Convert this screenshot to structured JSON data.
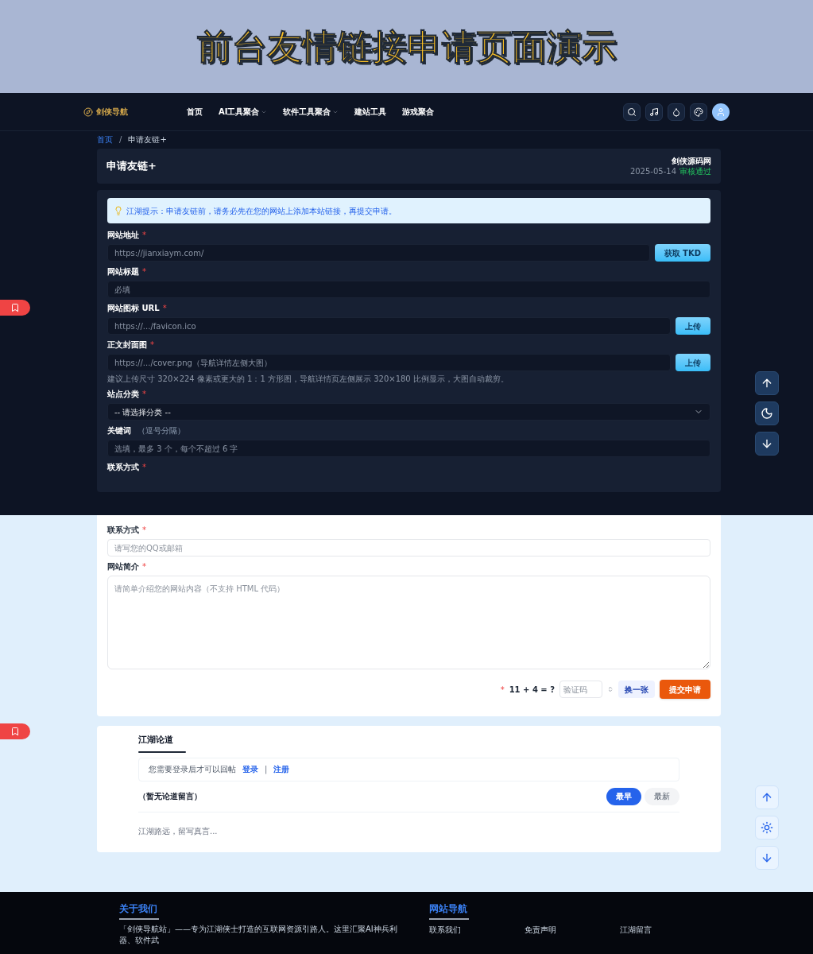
{
  "banner": {
    "title": "前台友情链接申请页面演示"
  },
  "nav": {
    "logo": "剑侠导航",
    "items": [
      {
        "label": "首页",
        "has_menu": false
      },
      {
        "label": "AI工具聚合",
        "has_menu": true
      },
      {
        "label": "软件工具聚合",
        "has_menu": true
      },
      {
        "label": "建站工具",
        "has_menu": false
      },
      {
        "label": "游戏聚合",
        "has_menu": false
      }
    ]
  },
  "required_mark": "*",
  "breadcrumb_separator": "/",
  "breadcrumb": [
    {
      "label": "首页",
      "kind": "link"
    },
    {
      "label": "申请友链+",
      "kind": "current"
    }
  ],
  "header": {
    "title": "申请友链+",
    "site": "剑侠源码网",
    "date": "2025-05-14",
    "status": "审核通过"
  },
  "notice": "江湖提示：申请友链前，请务必先在您的网站上添加本站链接，再提交申请。",
  "dark_fields": [
    {
      "kind": "input",
      "label": "网站地址",
      "required": true,
      "placeholder": "https://jianxiaym.com/",
      "button": "获取 TKD"
    },
    {
      "kind": "input",
      "label": "网站标题",
      "required": true,
      "placeholder": "必填"
    },
    {
      "kind": "input",
      "label": "网站图标 URL",
      "required": true,
      "placeholder": "https://.../favicon.ico",
      "button": "上传"
    },
    {
      "kind": "input",
      "label": "正文封面图",
      "required": true,
      "placeholder": "https://.../cover.png（导航详情左侧大图）",
      "button": "上传",
      "note": "建议上传尺寸 320×224 像素或更大的 1：1 方形图，导航详情页左侧展示 320×180 比例显示，大图自动裁剪。"
    },
    {
      "kind": "select",
      "label": "站点分类",
      "required": true,
      "value": "-- 请选择分类 --"
    },
    {
      "kind": "input",
      "label": "关键词",
      "required": false,
      "hint": "（逗号分隔）",
      "placeholder": "选填，最多 3 个，每个不超过 6 字"
    },
    {
      "kind": "label_only",
      "label": "联系方式",
      "required": true
    }
  ],
  "light_fields": [
    {
      "kind": "input",
      "label": "联系方式",
      "required": true,
      "placeholder": "请写您的QQ或邮箱"
    },
    {
      "kind": "textarea",
      "label": "网站简介",
      "required": true,
      "placeholder": "请简单介绍您的网站内容（不支持 HTML 代码）"
    }
  ],
  "captcha": {
    "question": "11 + 4 = ?",
    "placeholder": "验证码",
    "refresh": "换一张",
    "submit": "提交申请"
  },
  "comments": {
    "title": "江湖论道",
    "login_text": "您需要登录后才可以回帖",
    "login": "登录",
    "separator": "|",
    "register": "注册",
    "empty": "（暂无论道留言）",
    "sorts": [
      {
        "label": "最早",
        "selected": true
      },
      {
        "label": "最新",
        "selected": false
      }
    ],
    "placeholder": "江湖路远，留写真言..."
  },
  "footer": {
    "about_title": "关于我们",
    "about_text": "「剑侠导航站」——专为江湖侠士打造的互联网资源引路人。这里汇聚AI神兵利器、软件武",
    "nav_title": "网站导航",
    "links": [
      "联系我们",
      "免责声明",
      "江湖留言"
    ]
  }
}
